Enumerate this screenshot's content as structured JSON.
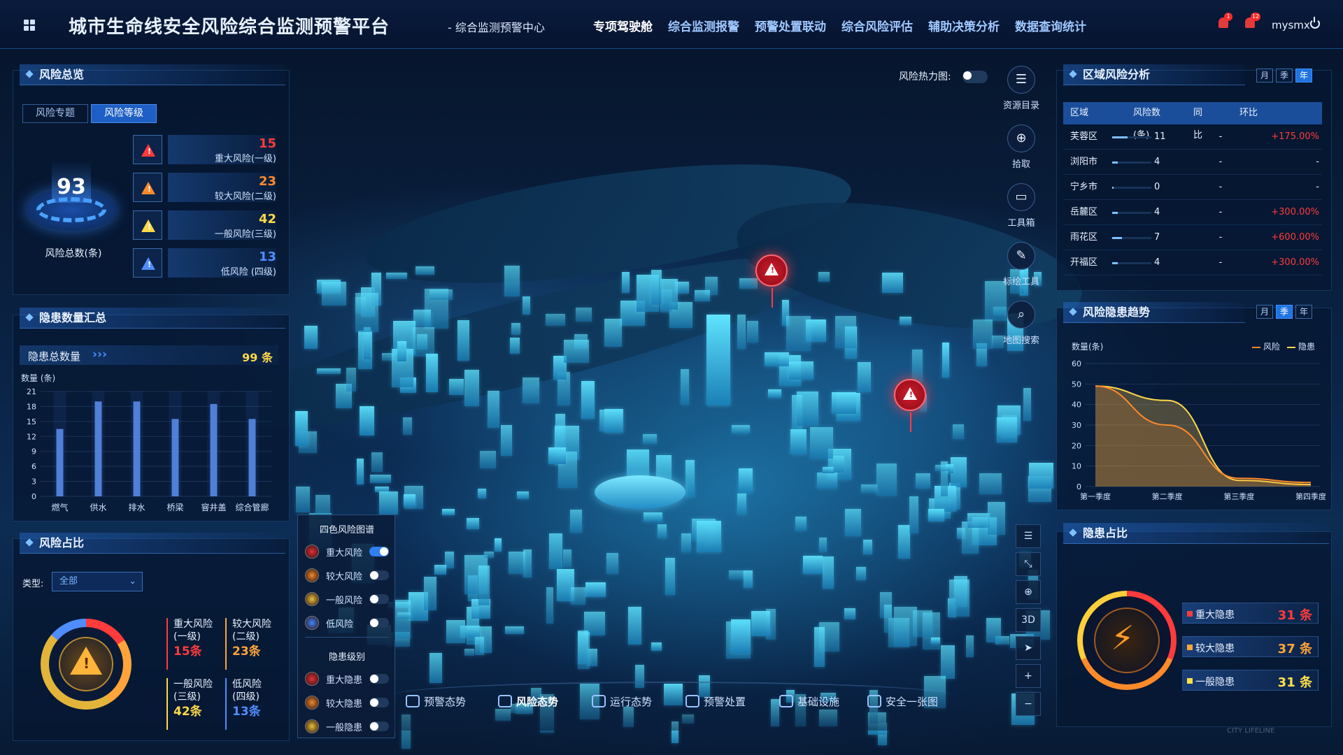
{
  "header": {
    "title": "城市生命线安全风险综合监测预警平台",
    "subtitle": "- 综合监测预警中心",
    "nav": [
      "专项驾驶舱",
      "综合监测报警",
      "预警处置联动",
      "综合风险评估",
      "辅助决策分析",
      "数据查询统计"
    ],
    "bell1_badge": "1",
    "bell2_badge": "12",
    "user": "mysmx"
  },
  "risk_overview": {
    "title": "风险总览",
    "tabs": [
      "风险专题",
      "风险等级"
    ],
    "total": "93",
    "total_label": "风险总数(条)",
    "levels": [
      {
        "value": "15",
        "label": "重大风险(一级)",
        "color": "#ff3b3b"
      },
      {
        "value": "23",
        "label": "较大风险(二级)",
        "color": "#ff8a2a"
      },
      {
        "value": "42",
        "label": "一般风险(三级)",
        "color": "#ffd84a"
      },
      {
        "value": "13",
        "label": "低风险 (四级)",
        "color": "#4f8dff"
      }
    ]
  },
  "hazard_summary": {
    "title": "隐患数量汇总",
    "total_label": "隐患总数量",
    "arrows": "›››",
    "total_value": "99 条",
    "ylabel": "数量 (条)"
  },
  "risk_ratio": {
    "title": "风险占比",
    "type_label": "类型:",
    "type_value": "全部",
    "items": [
      {
        "name": "重大风险",
        "sub": "(一级)",
        "count": "15条",
        "color": "#ff3b3b"
      },
      {
        "name": "较大风险",
        "sub": "(二级)",
        "count": "23条",
        "color": "#ffa43a"
      },
      {
        "name": "一般风险",
        "sub": "(三级)",
        "count": "42条",
        "color": "#ffd84a"
      },
      {
        "name": "低风险",
        "sub": "(四级)",
        "count": "13条",
        "color": "#4f8dff"
      }
    ]
  },
  "legend": {
    "title": "四色风险图谱",
    "risks": [
      {
        "label": "重大风险",
        "on": true,
        "color": "#e22f3a"
      },
      {
        "label": "较大风险",
        "on": false,
        "color": "#f08a2a"
      },
      {
        "label": "一般风险",
        "on": false,
        "color": "#e8c23a"
      },
      {
        "label": "低风险",
        "on": false,
        "color": "#3f86ff"
      }
    ],
    "hazard_title": "隐患级别",
    "hazards": [
      {
        "label": "重大隐患",
        "color": "#e22f3a"
      },
      {
        "label": "较大隐患",
        "color": "#f08a2a"
      },
      {
        "label": "一般隐患",
        "color": "#e8c23a"
      }
    ]
  },
  "heatmap_label": "风险热力图:",
  "tools": [
    "资源目录",
    "拾取",
    "工具箱",
    "标绘工具",
    "地图搜索"
  ],
  "map_controls": [
    "☰",
    "⤡",
    "⊕",
    "3D",
    "➤",
    "+",
    "−"
  ],
  "bottom_nav": [
    "预警态势",
    "风险态势",
    "运行态势",
    "预警处置",
    "基础设施",
    "安全一张图"
  ],
  "watermark": "CITY LIFELINE",
  "region": {
    "title": "区域风险分析",
    "seg": [
      "月",
      "季",
      "年"
    ],
    "headers": [
      "区域",
      "风险数(条)",
      "同比",
      "环比"
    ],
    "rows": [
      {
        "name": "芙蓉区",
        "count": "11",
        "yoy": "-",
        "mom": "+175.00%"
      },
      {
        "name": "浏阳市",
        "count": "4",
        "yoy": "-",
        "mom": "-"
      },
      {
        "name": "宁乡市",
        "count": "0",
        "yoy": "-",
        "mom": "-"
      },
      {
        "name": "岳麓区",
        "count": "4",
        "yoy": "-",
        "mom": "+300.00%"
      },
      {
        "name": "雨花区",
        "count": "7",
        "yoy": "-",
        "mom": "+600.00%"
      },
      {
        "name": "开福区",
        "count": "4",
        "yoy": "-",
        "mom": "+300.00%"
      }
    ]
  },
  "trend": {
    "title": "风险隐患趋势",
    "seg": [
      "月",
      "季",
      "年"
    ],
    "ylabel": "数量(条)",
    "legend": [
      "风险",
      "隐患"
    ]
  },
  "hazard_ratio": {
    "title": "隐患占比",
    "items": [
      {
        "label": "重大隐患",
        "value": "31 条",
        "color": "#ff3b3b"
      },
      {
        "label": "较大隐患",
        "value": "37 条",
        "color": "#ffa43a"
      },
      {
        "label": "一般隐患",
        "value": "31 条",
        "color": "#ffe14a"
      }
    ]
  },
  "chart_data": [
    {
      "type": "bar",
      "categories": [
        "燃气",
        "供水",
        "排水",
        "桥梁",
        "窨井盖",
        "综合管廊"
      ],
      "values": [
        13.5,
        19,
        19,
        15.5,
        18.5,
        15.5
      ],
      "ylabel": "数量 (条)",
      "ylim": [
        0,
        21
      ],
      "yticks": [
        0,
        3,
        6,
        9,
        12,
        15,
        18,
        21
      ]
    },
    {
      "type": "area",
      "categories": [
        "第一季度",
        "第二季度",
        "第三季度",
        "第四季度"
      ],
      "ylim": [
        0,
        60
      ],
      "yticks": [
        0,
        10,
        20,
        30,
        40,
        50,
        60
      ],
      "series": [
        {
          "name": "风险",
          "values": [
            49,
            30,
            4,
            2
          ]
        },
        {
          "name": "隐患",
          "values": [
            49,
            42,
            3,
            1
          ]
        }
      ]
    }
  ]
}
